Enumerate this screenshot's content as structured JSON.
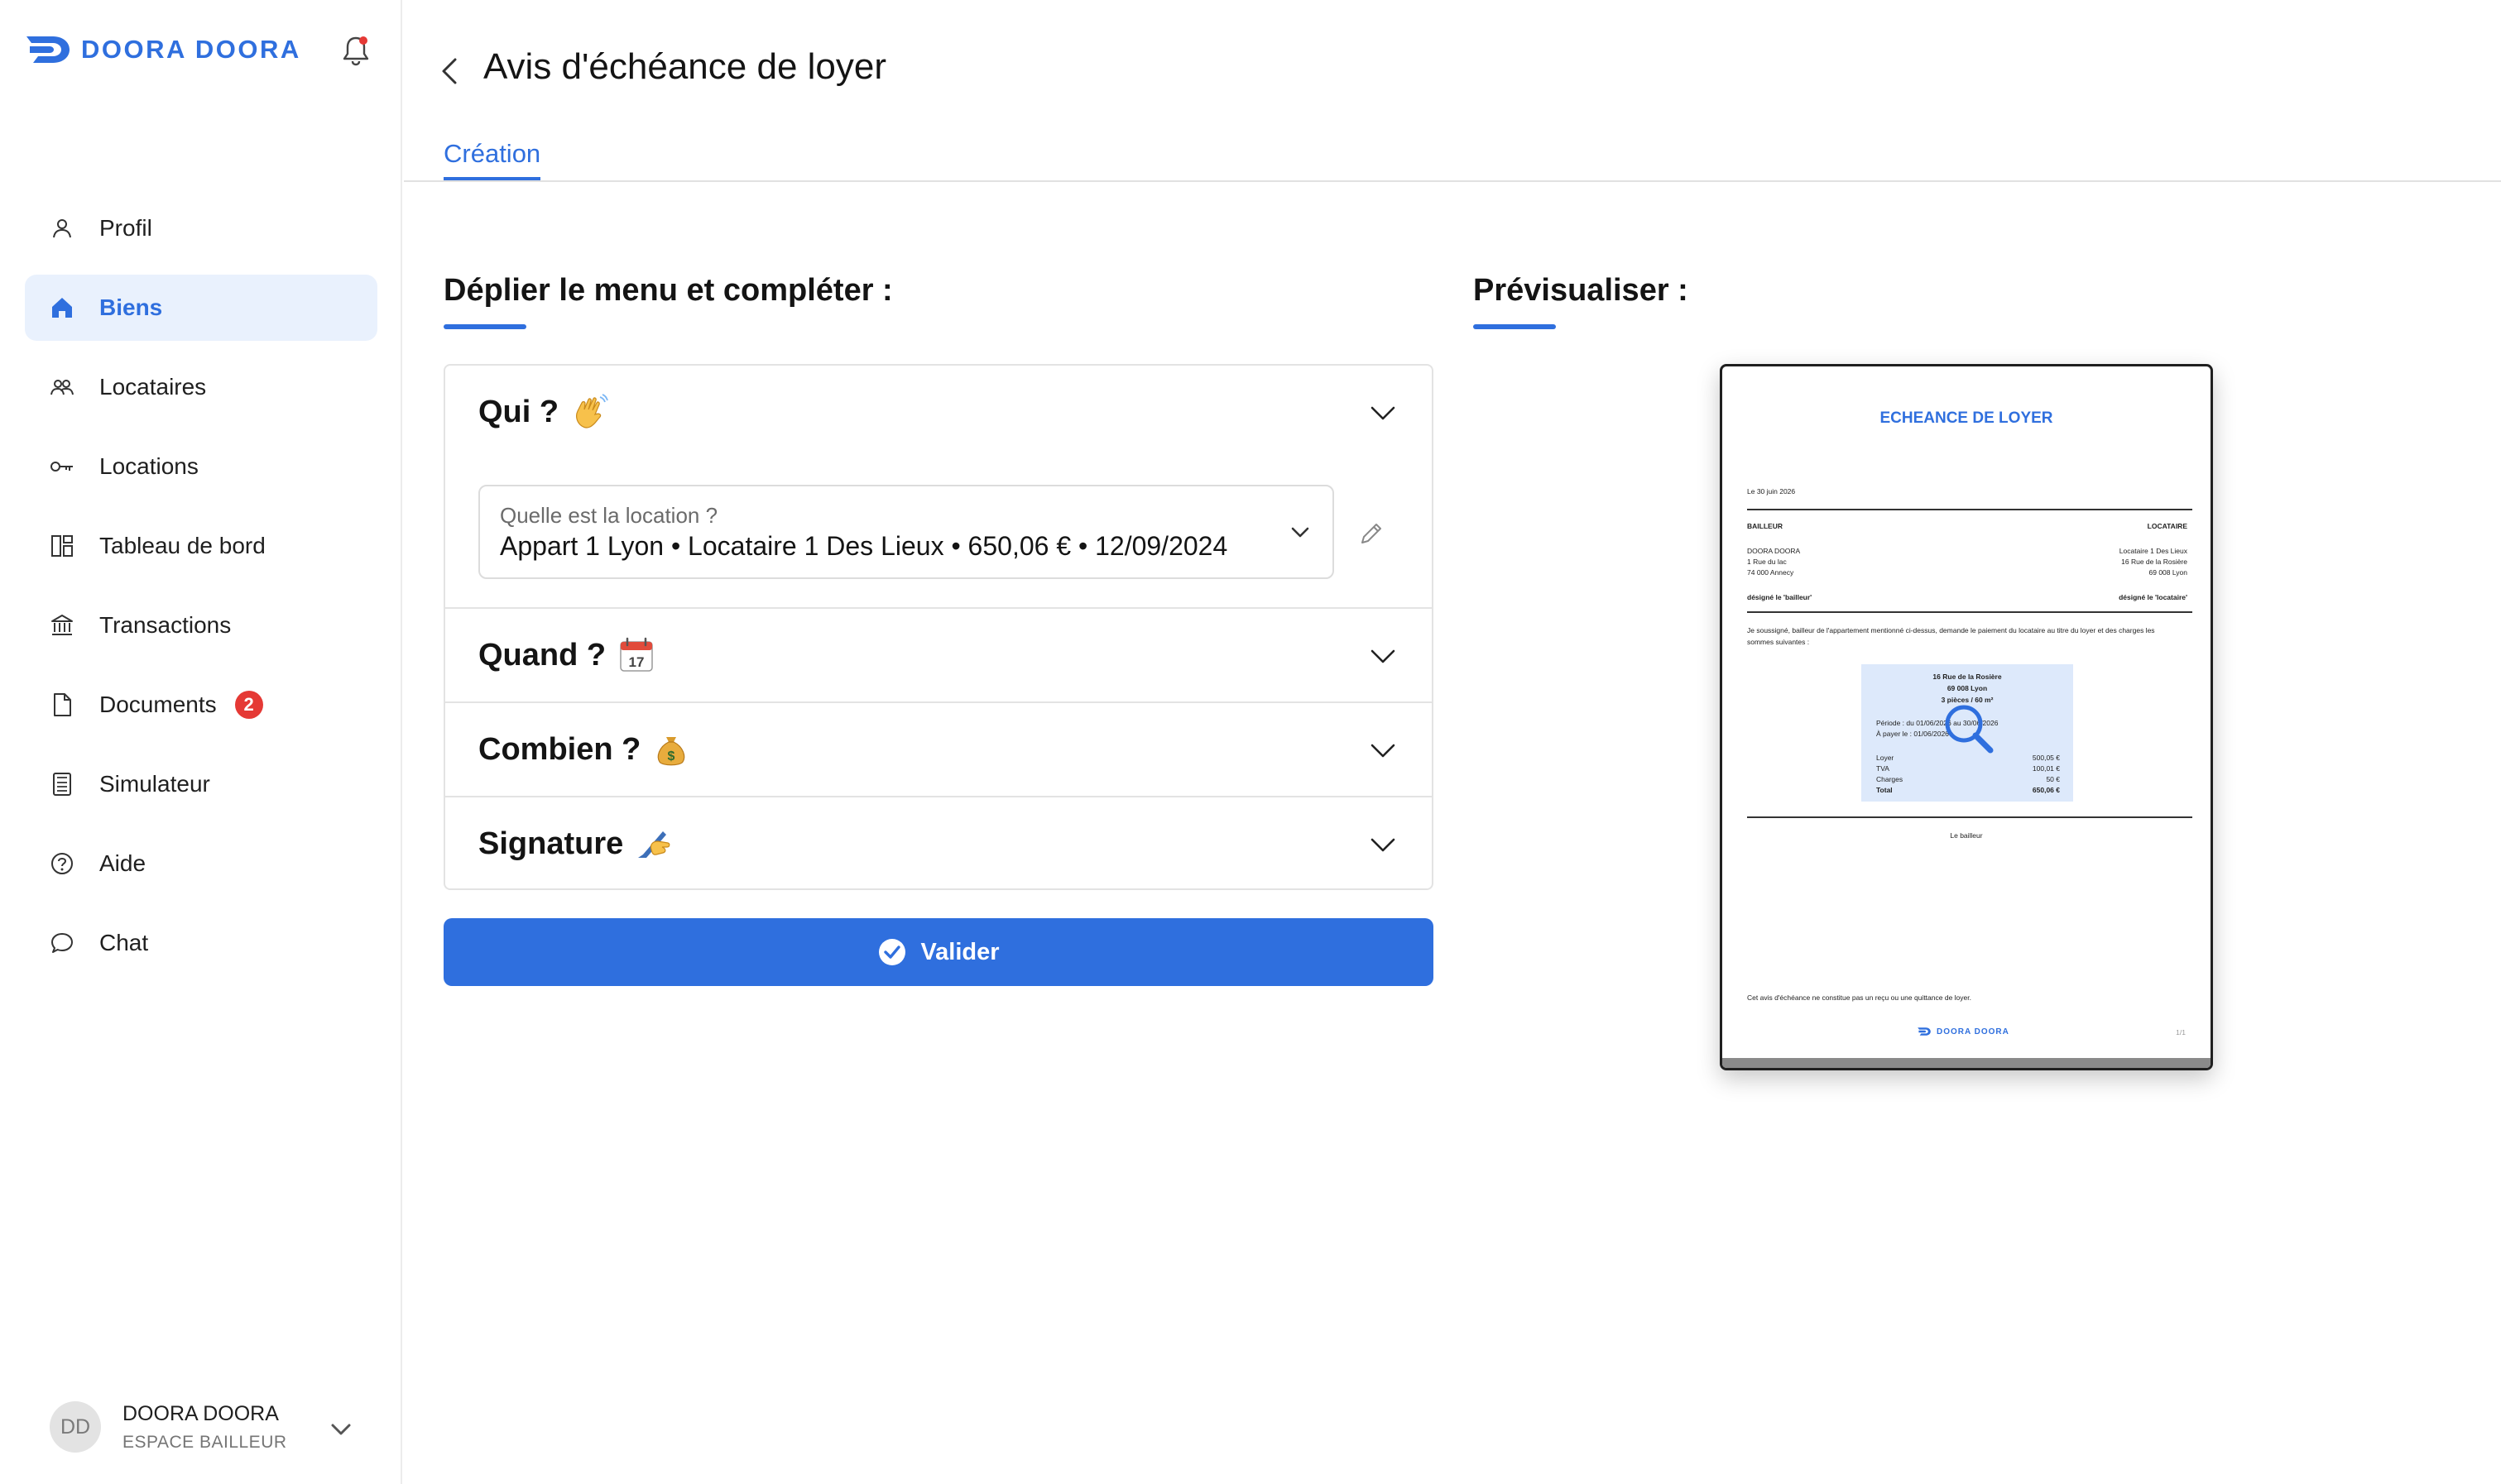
{
  "brand": {
    "name": "DOORA DOORA",
    "color": "#2f6fde"
  },
  "header": {
    "notifications_icon": "bell-icon"
  },
  "sidebar": {
    "items": [
      {
        "label": "Profil",
        "icon": "user-icon",
        "active": false
      },
      {
        "label": "Biens",
        "icon": "home-icon",
        "active": true
      },
      {
        "label": "Locataires",
        "icon": "users-icon",
        "active": false
      },
      {
        "label": "Locations",
        "icon": "key-icon",
        "active": false
      },
      {
        "label": "Tableau de bord",
        "icon": "dashboard-icon",
        "active": false
      },
      {
        "label": "Transactions",
        "icon": "bank-icon",
        "active": false
      },
      {
        "label": "Documents",
        "icon": "document-icon",
        "active": false,
        "badge": "2"
      },
      {
        "label": "Simulateur",
        "icon": "calculator-icon",
        "active": false
      },
      {
        "label": "Aide",
        "icon": "help-icon",
        "active": false
      },
      {
        "label": "Chat",
        "icon": "chat-icon",
        "active": false
      }
    ],
    "user": {
      "initials": "DD",
      "name": "DOORA DOORA",
      "role": "ESPACE BAILLEUR"
    }
  },
  "page": {
    "title": "Avis d'échéance de loyer",
    "tabs": [
      {
        "label": "Création",
        "active": true
      }
    ]
  },
  "form": {
    "heading": "Déplier le menu et compléter :",
    "sections": [
      {
        "title": "Qui ?",
        "emoji": "waving-hand-icon",
        "expanded": true
      },
      {
        "title": "Quand ?",
        "emoji": "calendar-icon",
        "expanded": false
      },
      {
        "title": "Combien ?",
        "emoji": "money-bag-icon",
        "expanded": false
      },
      {
        "title": "Signature",
        "emoji": "writing-hand-icon",
        "expanded": false
      }
    ],
    "location_select": {
      "label": "Quelle est la location ?",
      "value": "Appart 1 Lyon • Locataire 1 Des Lieux • 650,06 € • 12/09/2024"
    },
    "submit_label": "Valider"
  },
  "preview": {
    "heading": "Prévisualiser :",
    "document": {
      "title": "ECHEANCE DE LOYER",
      "date": "Le 30 juin 2026",
      "landlord_header": "BAILLEUR",
      "tenant_header": "LOCATAIRE",
      "landlord_lines": [
        "DOORA DOORA",
        "1 Rue du lac",
        "74 000 Annecy"
      ],
      "tenant_lines": [
        "Locataire 1 Des Lieux",
        "16 Rue de la Rosière",
        "69 008 Lyon"
      ],
      "landlord_designation": "désigné le 'bailleur'",
      "tenant_designation": "désigné le 'locataire'",
      "body_line1": "Je soussigné, bailleur de l'appartement mentionné ci-dessus, demande le paiement du locataire au titre du loyer et des charges les",
      "body_line2": "sommes suivantes :",
      "property_lines": [
        "16 Rue de la Rosière",
        "69 008 Lyon",
        "3 pièces / 60 m²"
      ],
      "period": "Période : du 01/06/2026 au 30/06/2026",
      "due": "À payer le : 01/06/2026",
      "amounts": [
        {
          "label": "Loyer",
          "value": "500,05 €"
        },
        {
          "label": "TVA",
          "value": "100,01 €"
        },
        {
          "label": "Charges",
          "value": "50 €"
        },
        {
          "label": "Total",
          "value": "650,06 €"
        }
      ],
      "signature": "Le bailleur",
      "disclaimer": "Cet avis d'échéance ne constitue pas un reçu ou une quittance de loyer.",
      "footer_brand": "DOORA DOORA",
      "page_number": "1/1"
    }
  }
}
